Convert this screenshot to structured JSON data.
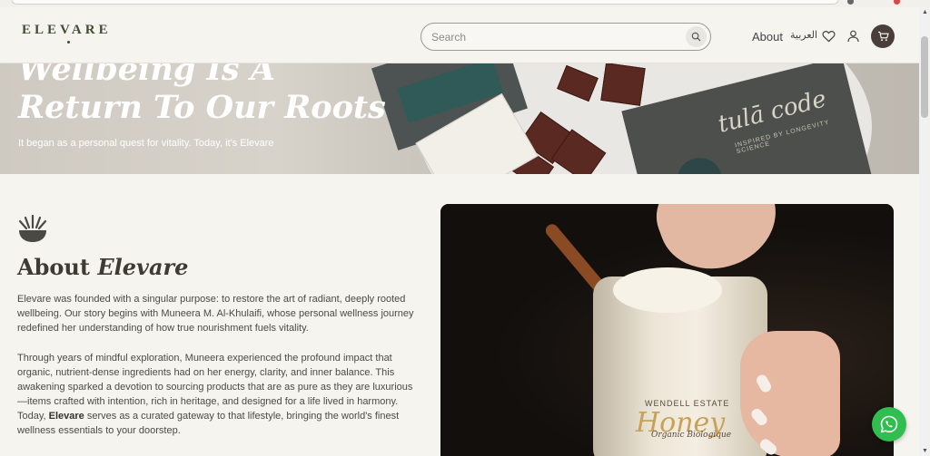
{
  "brand": {
    "logo": "ELEVARE"
  },
  "header": {
    "search_placeholder": "Search",
    "nav_about": "About",
    "nav_language": "العربية"
  },
  "hero": {
    "title_line1": "Wellbeing Is A",
    "title_line2": "Return To Our Roots",
    "subtitle": "It began as a personal quest for vitality. Today, it's Elevare",
    "box_brand": "tulā code",
    "box_sub": "INSPIRED BY LONGEVITY SCIENCE"
  },
  "about": {
    "title_plain": "About ",
    "title_italic": "Elevare",
    "p1": "Elevare was founded with a singular purpose: to restore the art of radiant, deeply rooted wellbeing. Our story begins with Muneera M. Al-Khulaifi, whose personal wellness journey redefined her understanding of how true nourishment fuels vitality.",
    "p2_before": "Through years of mindful exploration, Muneera experienced the profound impact that organic, nutrient-dense ingredients had on her energy, clarity, and inner balance. This awakening sparked a devotion to sourcing products that are as pure as they are luxurious—items crafted with intention, rich in heritage, and designed for a life lived in harmony. Today, ",
    "p2_bold": "Elevare",
    "p2_after": " serves as a curated gateway to that lifestyle, bringing the world's finest wellness essentials to your doorstep."
  },
  "photo": {
    "jar_maker": "WENDELL ESTATE",
    "jar_product": "Honey",
    "jar_note": "Organic Biologique"
  },
  "icons": {
    "search": "search-icon",
    "heart": "heart-icon",
    "user": "user-icon",
    "cart": "cart-icon",
    "whatsapp": "whatsapp-icon",
    "about": "sunrise-bowl-icon"
  },
  "colors": {
    "background": "#f6f4ef",
    "brand": "#3f4d33",
    "cart_button": "#4a3f38",
    "whatsapp": "#2fbe4f"
  }
}
